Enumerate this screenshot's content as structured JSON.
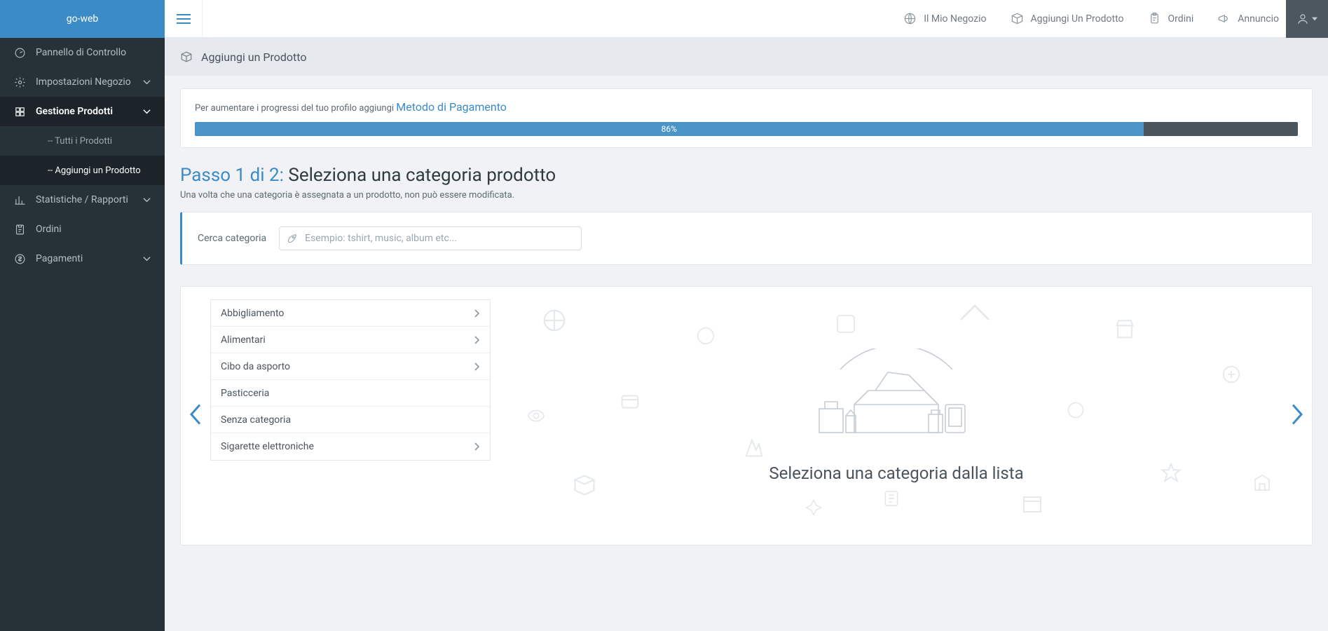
{
  "brand": "go-web",
  "sidebar": {
    "items": [
      {
        "label": "Pannello di Controllo",
        "name": "nav-dashboard",
        "expandable": false
      },
      {
        "label": "Impostazioni Negozio",
        "name": "nav-store-settings",
        "expandable": true
      },
      {
        "label": "Gestione Prodotti",
        "name": "nav-product-mgmt",
        "expandable": true,
        "active": true
      },
      {
        "label": "Statistiche / Rapporti",
        "name": "nav-reports",
        "expandable": true
      },
      {
        "label": "Ordini",
        "name": "nav-orders",
        "expandable": false
      },
      {
        "label": "Pagamenti",
        "name": "nav-payments",
        "expandable": true
      }
    ],
    "subitems": [
      {
        "label": "-- Tutti i Prodotti",
        "name": "subnav-all-products"
      },
      {
        "label": "-- Aggiungi un Prodotto",
        "name": "subnav-add-product",
        "active": true
      }
    ]
  },
  "topbar": {
    "links": [
      {
        "label": "Il Mio Negozio",
        "name": "toplink-my-store",
        "icon": "globe"
      },
      {
        "label": "Aggiungi Un Prodotto",
        "name": "toplink-add-product",
        "icon": "box"
      },
      {
        "label": "Ordini",
        "name": "toplink-orders",
        "icon": "clipboard"
      },
      {
        "label": "Annuncio",
        "name": "toplink-announce",
        "icon": "megaphone"
      }
    ]
  },
  "subheader": {
    "title": "Aggiungi un Prodotto"
  },
  "profile_progress": {
    "text": "Per aumentare i progressi del tuo profilo aggiungi ",
    "link": "Metodo di Pagamento",
    "percent": 86,
    "percent_label": "86%"
  },
  "step": {
    "accent": "Passo 1 di 2:",
    "title": " Seleziona una categoria prodotto",
    "note": "Una volta che una categoria è assegnata a un prodotto, non può essere modificata."
  },
  "search": {
    "label": "Cerca categoria",
    "placeholder": "Esempio: tshirt, music, album etc..."
  },
  "categories": [
    {
      "label": "Abbigliamento",
      "has_children": true
    },
    {
      "label": "Alimentari",
      "has_children": true
    },
    {
      "label": "Cibo da asporto",
      "has_children": true
    },
    {
      "label": "Pasticceria",
      "has_children": false
    },
    {
      "label": "Senza categoria",
      "has_children": false
    },
    {
      "label": "Sigarette elettroniche",
      "has_children": true
    }
  ],
  "placeholder": {
    "title": "Seleziona una categoria dalla lista"
  }
}
